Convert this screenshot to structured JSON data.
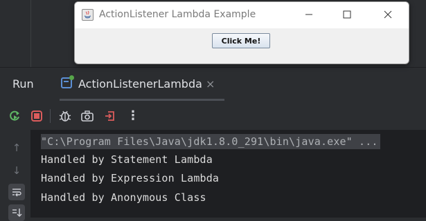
{
  "swing_window": {
    "title": "ActionListener Lambda Example",
    "button_label": "Click Me!"
  },
  "run_panel": {
    "title": "Run",
    "tab_label": "ActionListenerLambda",
    "tab_close": "×"
  },
  "toolbar": {
    "icons": [
      "rerun-icon",
      "stop-icon",
      "debug-icon",
      "screenshot-icon",
      "exit-icon",
      "more-icon"
    ],
    "more_label": "⋮"
  },
  "console": {
    "lines": [
      "\"C:\\Program Files\\Java\\jdk1.8.0_291\\bin\\java.exe\" ...",
      "Handled by Statement Lambda",
      "Handled by Expression Lambda",
      "Handled by Anonymous Class"
    ]
  },
  "colors": {
    "ide_background": "#2b2d30",
    "console_background": "#1e1f22",
    "rerun_green": "#5fb865",
    "stop_red": "#db5c5c",
    "tab_badge_green": "#57a64a"
  }
}
